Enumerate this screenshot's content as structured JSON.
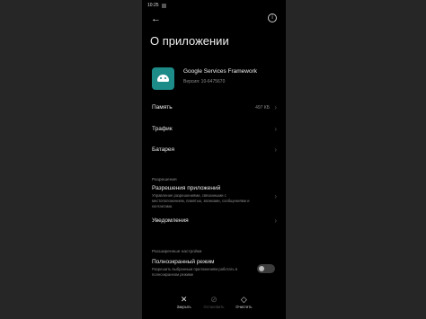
{
  "status": {
    "time": "10:25"
  },
  "header": {
    "title": "О приложении",
    "back_glyph": "←",
    "info_glyph": "i"
  },
  "app": {
    "name": "Google Services Framework",
    "version": "Версия: 10-6475670"
  },
  "rows": {
    "memory": {
      "label": "Память",
      "value": "497 КБ"
    },
    "traffic": {
      "label": "Трафик"
    },
    "battery": {
      "label": "Батарея"
    }
  },
  "permissions": {
    "section": "Разрешения",
    "title": "Разрешения приложений",
    "desc": "Управление разрешениями, связанными с местоположением, памятью, звонками, сообщениями и контактами.",
    "notifications": "Уведомления"
  },
  "advanced": {
    "section": "Расширенные настройки",
    "fullscreen_title": "Полноэкранный режим",
    "fullscreen_desc": "Разрешить выбранным приложениям работать в полноэкранном режиме",
    "fullscreen_on": false
  },
  "bottom": {
    "close": {
      "label": "Закрыть",
      "glyph": "✕"
    },
    "stop": {
      "label": "Остановить",
      "glyph": "⊘"
    },
    "clear": {
      "label": "Очистить",
      "glyph": "◇"
    }
  },
  "chevron": "›"
}
